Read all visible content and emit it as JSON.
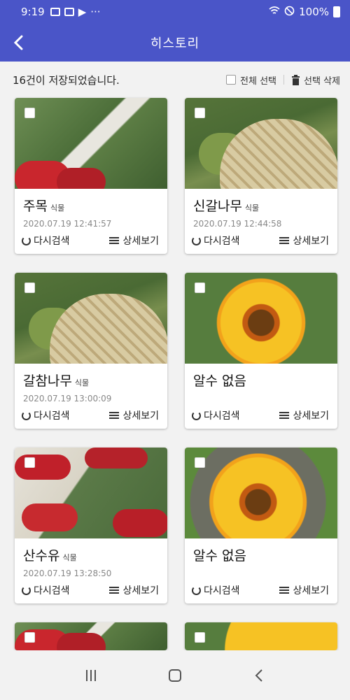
{
  "status": {
    "time": "9:19",
    "battery": "100%",
    "more": "···"
  },
  "header": {
    "title": "히스토리"
  },
  "toolbar": {
    "count_text": "16건이 저장되었습니다.",
    "select_all": "전체 선택",
    "delete_selected": "선택 삭제"
  },
  "cards": [
    {
      "name": "주목",
      "category": "식물",
      "date": "2020.07.19 12:41:57",
      "research": "다시검색",
      "detail": "상세보기",
      "image": "berry"
    },
    {
      "name": "신갈나무",
      "category": "식물",
      "date": "2020.07.19 12:44:58",
      "research": "다시검색",
      "detail": "상세보기",
      "image": "acorn"
    },
    {
      "name": "갈참나무",
      "category": "식물",
      "date": "2020.07.19 13:00:09",
      "research": "다시검색",
      "detail": "상세보기",
      "image": "acorn"
    },
    {
      "name": "알수 없음",
      "category": "",
      "date": "",
      "research": "다시검색",
      "detail": "상세보기",
      "image": "sunflower"
    },
    {
      "name": "산수유",
      "category": "식물",
      "date": "2020.07.19 13:28:50",
      "research": "다시검색",
      "detail": "상세보기",
      "image": "cornel"
    },
    {
      "name": "알수 없음",
      "category": "",
      "date": "",
      "research": "다시검색",
      "detail": "상세보기",
      "image": "sunflower"
    }
  ],
  "colors": {
    "primary": "#4a55c8",
    "background": "#f2f2f2"
  }
}
